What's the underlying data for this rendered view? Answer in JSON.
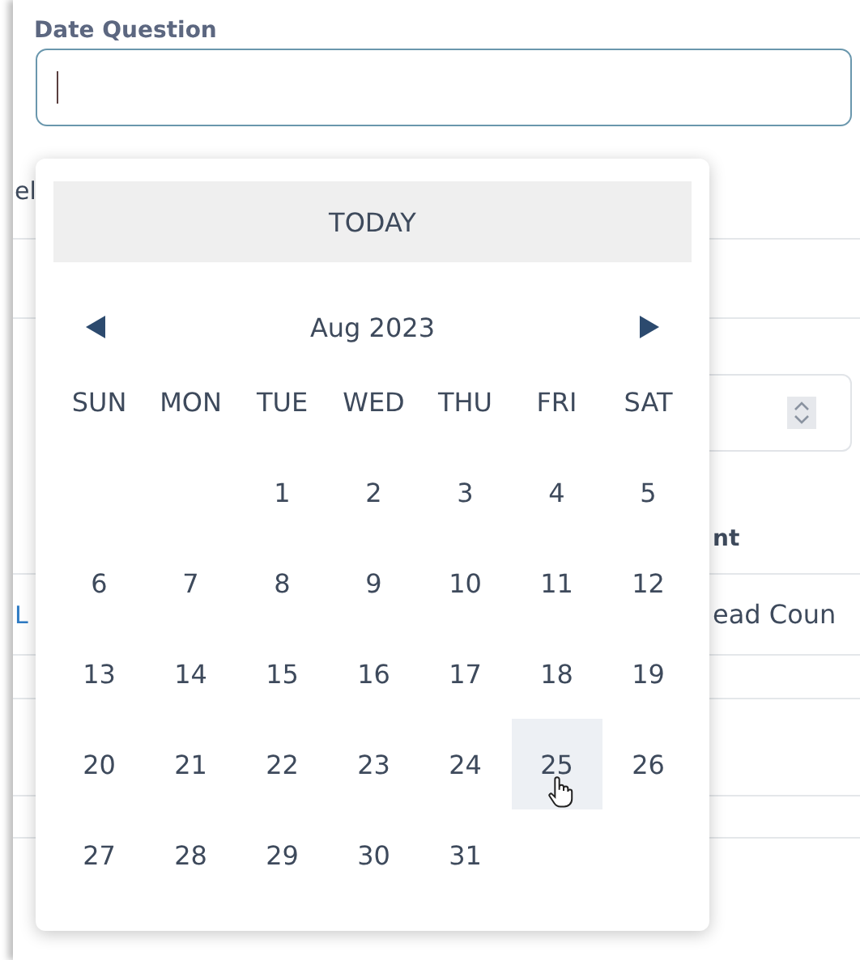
{
  "field": {
    "label": "Date Question",
    "focused": true
  },
  "background": {
    "row_1_left": "el",
    "column_fragment": "nt",
    "row_2_left": "L",
    "row_2_right": "ead Coun"
  },
  "calendar": {
    "today_button": "TODAY",
    "month": "Aug 2023",
    "weekdays": [
      "SUN",
      "MON",
      "TUE",
      "WED",
      "THU",
      "FRI",
      "SAT"
    ],
    "weeks": [
      [
        {
          "kind": "blank"
        },
        {
          "kind": "blank"
        },
        {
          "kind": "day",
          "day": "1",
          "selected": false
        },
        {
          "kind": "day",
          "day": "2",
          "selected": false
        },
        {
          "kind": "day",
          "day": "3",
          "selected": false
        },
        {
          "kind": "day",
          "day": "4",
          "selected": false
        },
        {
          "kind": "day",
          "day": "5",
          "selected": false
        }
      ],
      [
        {
          "kind": "day",
          "day": "6",
          "selected": false
        },
        {
          "kind": "day",
          "day": "7",
          "selected": false
        },
        {
          "kind": "day",
          "day": "8",
          "selected": false
        },
        {
          "kind": "day",
          "day": "9",
          "selected": false
        },
        {
          "kind": "day",
          "day": "10",
          "selected": false
        },
        {
          "kind": "day",
          "day": "11",
          "selected": false
        },
        {
          "kind": "day",
          "day": "12",
          "selected": false
        }
      ],
      [
        {
          "kind": "day",
          "day": "13",
          "selected": false
        },
        {
          "kind": "day",
          "day": "14",
          "selected": false
        },
        {
          "kind": "day",
          "day": "15",
          "selected": false
        },
        {
          "kind": "day",
          "day": "16",
          "selected": false
        },
        {
          "kind": "day",
          "day": "17",
          "selected": false
        },
        {
          "kind": "day",
          "day": "18",
          "selected": false
        },
        {
          "kind": "day",
          "day": "19",
          "selected": false
        }
      ],
      [
        {
          "kind": "day",
          "day": "20",
          "selected": false
        },
        {
          "kind": "day",
          "day": "21",
          "selected": false
        },
        {
          "kind": "day",
          "day": "22",
          "selected": false
        },
        {
          "kind": "day",
          "day": "23",
          "selected": false
        },
        {
          "kind": "day",
          "day": "24",
          "selected": false
        },
        {
          "kind": "day",
          "day": "25",
          "selected": true
        },
        {
          "kind": "day",
          "day": "26",
          "selected": false
        }
      ],
      [
        {
          "kind": "day",
          "day": "27",
          "selected": false
        },
        {
          "kind": "day",
          "day": "28",
          "selected": false
        },
        {
          "kind": "day",
          "day": "29",
          "selected": false
        },
        {
          "kind": "day",
          "day": "30",
          "selected": false
        },
        {
          "kind": "day",
          "day": "31",
          "selected": false
        },
        {
          "kind": "blank"
        },
        {
          "kind": "blank"
        }
      ]
    ]
  }
}
